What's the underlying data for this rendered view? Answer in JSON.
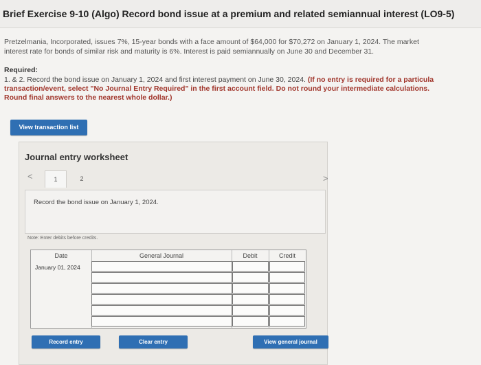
{
  "header": {
    "title": "Brief Exercise 9-10 (Algo) Record bond issue at a premium and related semiannual interest (LO9-5)"
  },
  "problem": {
    "line1": "Pretzelmania, Incorporated, issues 7%, 15-year bonds with a face amount of $64,000 for $70,272 on January 1, 2024. The market",
    "line2": "interest rate for bonds of similar risk and maturity is 6%. Interest is paid semiannually on June 30 and December 31."
  },
  "required": {
    "heading": "Required:",
    "line1_plain": "1. & 2. Record the bond issue on January 1, 2024 and first interest payment on June 30, 2024.",
    "line1_bold": " (If no entry is required for a particula",
    "line2": "transaction/event, select \"No Journal Entry Required\" in the first account field. Do not round your intermediate calculations.",
    "line3": "Round final answers to the nearest whole dollar.)"
  },
  "buttons": {
    "view_transactions": "View transaction list",
    "record_entry": "Record entry",
    "clear_entry": "Clear entry",
    "view_general_journal": "View general journal"
  },
  "worksheet": {
    "title": "Journal entry worksheet",
    "tabs": [
      "1",
      "2"
    ],
    "prev": "<",
    "next": ">",
    "entry_description": "Record the bond issue on January 1, 2024.",
    "note": "Note: Enter debits before credits."
  },
  "journal": {
    "headers": {
      "date": "Date",
      "general_journal": "General Journal",
      "debit": "Debit",
      "credit": "Credit"
    },
    "date_value": "January 01, 2024",
    "row_count": 6
  },
  "colors": {
    "accent_button": "#2f6fb3",
    "warning_text": "#a0342a"
  }
}
